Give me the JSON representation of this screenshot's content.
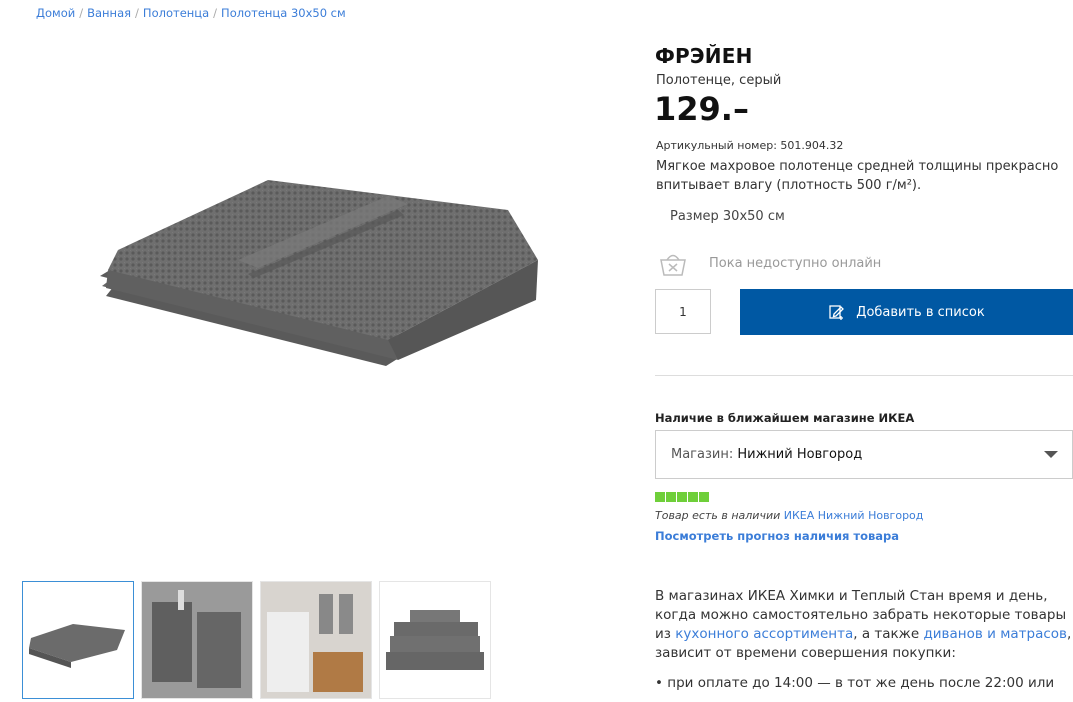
{
  "breadcrumb": {
    "items": [
      "Домой",
      "Ванная",
      "Полотенца",
      "Полотенца 30x50 см"
    ],
    "separator": "/"
  },
  "product": {
    "name": "ФРЭЙЕН",
    "subtitle": "Полотенце, серый",
    "price": "129.–",
    "article": "Артикульный номер: 501.904.32",
    "description": "Мягкое махровое полотенце средней толщины прекрасно впитывает влагу (плотность 500 г/м²).",
    "size": "Размер 30x50 см",
    "online_status": "Пока недоступно онлайн",
    "quantity": "1",
    "add_button": "Добавить в список"
  },
  "availability": {
    "title": "Наличие в ближайшем магазине ИКЕА",
    "store_label": "Магазин:",
    "store_value": "Нижний Новгород",
    "stock_level": 5,
    "stock_max": 5,
    "stock_color": "#6fcf3a",
    "stock_text": "Товар есть в наличии",
    "stock_store": "ИКЕА Нижний Новгород",
    "forecast_link": "Посмотреть прогноз наличия товара"
  },
  "info": {
    "part1": "В магазинах ИКЕА Химки и Теплый Стан время и день, когда можно самостоятельно забрать некоторые товары из ",
    "link1": "кухонного ассортимента",
    "part2": ", а также ",
    "link2": "диванов и матрасов",
    "part3": ", зависит от времени совершения покупки:",
    "bullet": "• при оплате до 14:00 — в тот же день после 22:00 или"
  },
  "colors": {
    "accent": "#0058a3",
    "link": "#3b7dd8"
  },
  "icons": {
    "basket": "basket-unavailable-icon",
    "list": "add-to-list-icon",
    "dropdown": "chevron-down-icon"
  }
}
